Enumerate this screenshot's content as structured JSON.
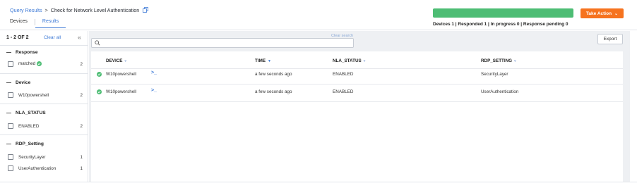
{
  "header": {
    "breadcrumb_link": "Query Results",
    "breadcrumb_sep": ">",
    "breadcrumb_current": "Check for Network Level Authentication",
    "tabs": [
      {
        "label": "Devices",
        "active": false
      },
      {
        "label": "Results",
        "active": true
      }
    ],
    "progress_percent": 100,
    "progress_color": "#4dbd74",
    "summary": "Devices 1 | Responded 1 | In progress 0 | Response pending 0",
    "take_action_label": "Take Action",
    "accent_color": "#f6731f"
  },
  "left_panel": {
    "count": "1 - 2 OF 2",
    "clear_all": "Clear all",
    "collapse_icon": "double-chevron-left-icon",
    "facets": [
      {
        "title": "Response",
        "items": [
          {
            "label": "matched",
            "count": "2",
            "checked_icon": true
          }
        ]
      },
      {
        "title": "Device",
        "items": [
          {
            "label": "W10powershell",
            "count": "2"
          }
        ]
      },
      {
        "title": "NLA_STATUS",
        "items": [
          {
            "label": "ENABLED",
            "count": "2"
          }
        ]
      },
      {
        "title": "RDP_Setting",
        "items": [
          {
            "label": "SecurityLayer",
            "count": "1"
          },
          {
            "label": "UserAuthentication",
            "count": "1"
          }
        ]
      }
    ]
  },
  "main": {
    "search_value": "",
    "search_placeholder": "",
    "clear_search": "Clear search",
    "export_label": "Export",
    "columns": [
      "DEVICE",
      "TIME",
      "NLA_STATUS",
      "RDP_SETTING"
    ],
    "rows": [
      {
        "device": "W10powershell",
        "time": "a few seconds ago",
        "nla_status": "ENABLED",
        "rdp_setting": "SecurityLayer"
      },
      {
        "device": "W10powershell",
        "time": "a few seconds ago",
        "nla_status": "ENABLED",
        "rdp_setting": "UserAuthentication"
      }
    ]
  }
}
